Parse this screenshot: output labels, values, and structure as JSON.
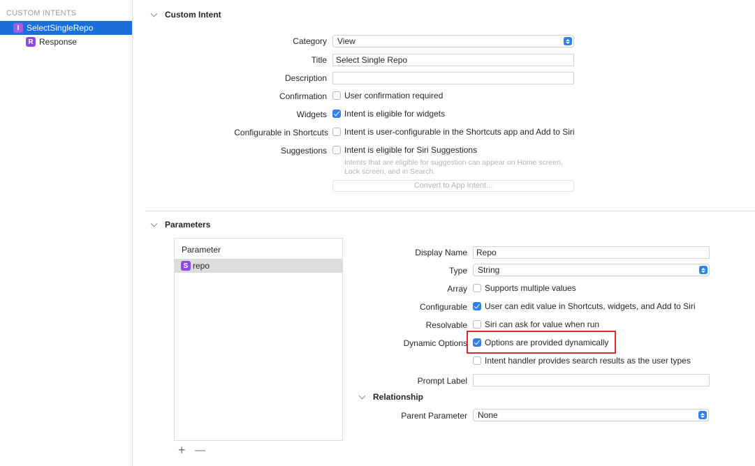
{
  "sidebar": {
    "header": "CUSTOM INTENTS",
    "items": [
      {
        "badge": "I",
        "label": "SelectSingleRepo",
        "selected": true
      },
      {
        "badge": "R",
        "label": "Response",
        "selected": false
      }
    ]
  },
  "custom_intent": {
    "title": "Custom Intent",
    "category_label": "Category",
    "category_value": "View",
    "title_label": "Title",
    "title_value": "Select Single Repo",
    "description_label": "Description",
    "description_value": "",
    "confirmation_label": "Confirmation",
    "confirmation_text": "User confirmation required",
    "widgets_label": "Widgets",
    "widgets_text": "Intent is eligible for widgets",
    "configurable_label": "Configurable in Shortcuts",
    "configurable_text": "Intent is user-configurable in the Shortcuts app and Add to Siri",
    "suggestions_label": "Suggestions",
    "suggestions_text": "Intent is eligible for Siri Suggestions",
    "suggestions_hint_line1": "Intents that are eligible for suggestion can appear on Home screen,",
    "suggestions_hint_line2": "Lock screen, and in Search.",
    "convert_button": "Convert to App Intent..."
  },
  "parameters": {
    "title": "Parameters",
    "list_header": "Parameter",
    "items": [
      {
        "badge": "S",
        "label": "repo"
      }
    ],
    "add": "+",
    "remove": "—"
  },
  "param_detail": {
    "display_name_label": "Display Name",
    "display_name_value": "Repo",
    "type_label": "Type",
    "type_value": "String",
    "array_label": "Array",
    "array_text": "Supports multiple values",
    "configurable_label": "Configurable",
    "configurable_text": "User can edit value in Shortcuts, widgets, and Add to Siri",
    "resolvable_label": "Resolvable",
    "resolvable_text": "Siri can ask for value when run",
    "dynamic_label": "Dynamic Options",
    "dynamic_text": "Options are provided dynamically",
    "search_text": "Intent handler provides search results as the user types",
    "prompt_label": "Prompt Label",
    "prompt_value": "",
    "relationship_title": "Relationship",
    "parent_label": "Parent Parameter",
    "parent_value": "None"
  },
  "colors": {
    "accent": "#2f7ff5",
    "selection": "#1a6fdc",
    "badge": "#8e4ae0",
    "highlight": "#e0272f"
  }
}
